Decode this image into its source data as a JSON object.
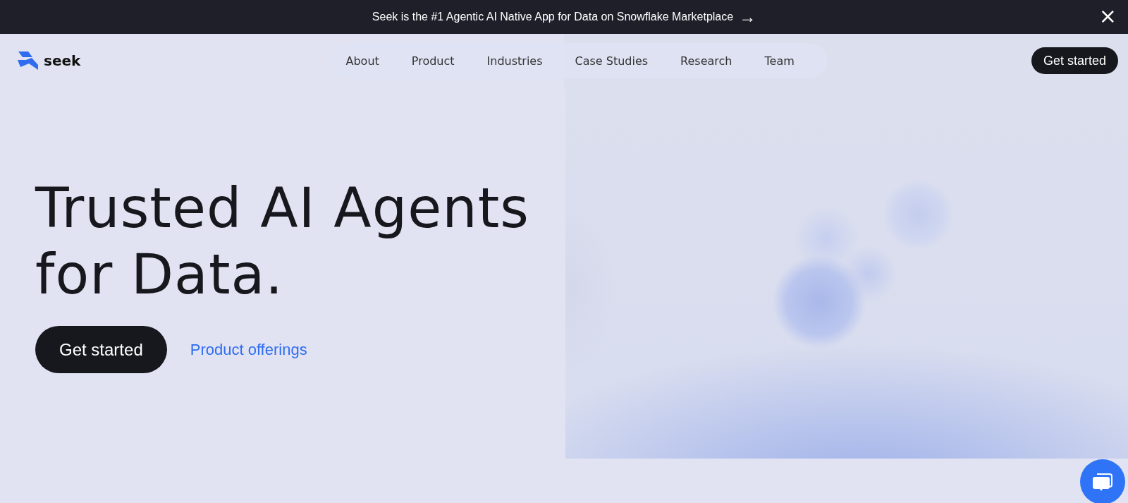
{
  "announcement": {
    "text": "Seek is the #1 Agentic AI Native App for Data on Snowflake Marketplace",
    "arrow": "→",
    "close": "×"
  },
  "header": {
    "logo_text": "seek",
    "nav": [
      {
        "label": "About"
      },
      {
        "label": "Product"
      },
      {
        "label": "Industries"
      },
      {
        "label": "Case Studies"
      },
      {
        "label": "Research"
      },
      {
        "label": "Team"
      }
    ],
    "cta": "Get started"
  },
  "hero": {
    "headline_lines": [
      "Trusted AI Agents",
      "for Data."
    ],
    "primary_button": "Get started",
    "secondary_link": "Product offerings"
  }
}
